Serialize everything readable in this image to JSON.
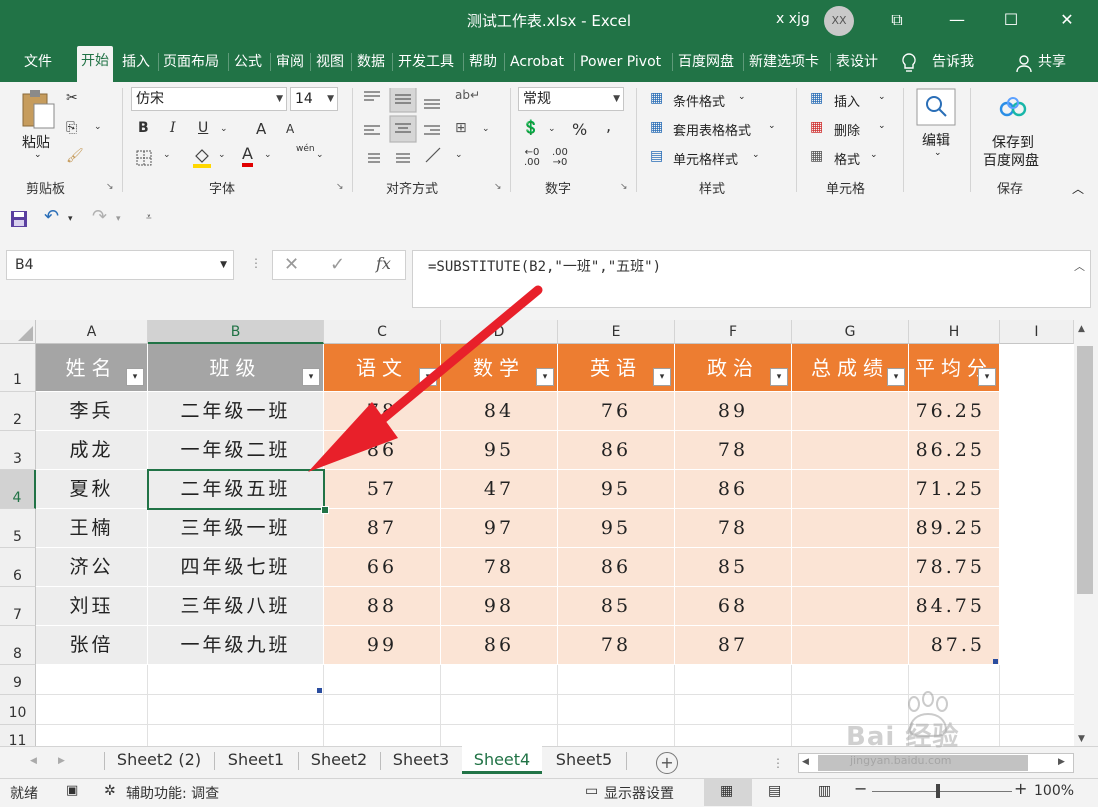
{
  "window": {
    "title": "测试工作表.xlsx  -  Excel",
    "user": "x xjg",
    "avatar": "XX",
    "minimize": "—",
    "maximize": "☐",
    "close": "✕",
    "restore": "⧉"
  },
  "menu": {
    "items": [
      "文件",
      "开始",
      "插入",
      "页面布局",
      "公式",
      "审阅",
      "视图",
      "数据",
      "开发工具",
      "帮助",
      "Acrobat",
      "Power Pivot",
      "百度网盘",
      "新建选项卡",
      "表设计"
    ],
    "tellme": "告诉我",
    "share": "共享"
  },
  "ribbon": {
    "clipboard": {
      "paste": "粘贴",
      "label": "剪贴板"
    },
    "font": {
      "name": "仿宋",
      "size": "14",
      "label": "字体",
      "bold": "B",
      "italic": "I",
      "underline": "U",
      "grow": "A",
      "shrink": "A",
      "color": "A",
      "wen": "wén"
    },
    "alignment": {
      "label": "对齐方式"
    },
    "number": {
      "format": "常规",
      "label": "数字",
      "percent": "%",
      "comma": ","
    },
    "styles": {
      "conditional": "条件格式",
      "table": "套用表格格式",
      "cell": "单元格样式",
      "label": "样式"
    },
    "cells": {
      "insert": "插入",
      "delete": "删除",
      "format": "格式",
      "label": "单元格"
    },
    "editing": {
      "label": "编辑"
    },
    "save": {
      "line1": "保存到",
      "line2": "百度网盘",
      "label": "保存"
    }
  },
  "formula_bar": {
    "name_box": "B4",
    "fx": "fx",
    "formula": "=SUBSTITUTE(B2,\"一班\",\"五班\")"
  },
  "grid": {
    "columns": [
      "A",
      "B",
      "C",
      "D",
      "E",
      "F",
      "G",
      "H",
      "I"
    ],
    "rows": [
      "1",
      "2",
      "3",
      "4",
      "5",
      "6",
      "7",
      "8",
      "9",
      "10",
      "11"
    ],
    "headers": [
      "姓名",
      "班级",
      "语文",
      "数学",
      "英语",
      "政治",
      "总成绩",
      "平均分"
    ],
    "data": [
      [
        "李兵",
        "二年级一班",
        "78",
        "84",
        "76",
        "89",
        "",
        "76.25"
      ],
      [
        "成龙",
        "一年级二班",
        "86",
        "95",
        "86",
        "78",
        "",
        "86.25"
      ],
      [
        "夏秋",
        "二年级五班",
        "57",
        "47",
        "95",
        "86",
        "",
        "71.25"
      ],
      [
        "王楠",
        "三年级一班",
        "87",
        "97",
        "95",
        "78",
        "",
        "89.25"
      ],
      [
        "济公",
        "四年级七班",
        "66",
        "78",
        "86",
        "85",
        "",
        "78.75"
      ],
      [
        "刘珏",
        "三年级八班",
        "88",
        "98",
        "85",
        "68",
        "",
        "84.75"
      ],
      [
        "张倍",
        "一年级九班",
        "99",
        "86",
        "78",
        "87",
        "",
        "87.5"
      ]
    ],
    "filter_glyph": "▾",
    "colors": {
      "header_gray": "#a5a5a5",
      "header_orange": "#ed7d31",
      "row_gray": "#ededed",
      "row_peach": "#fbe4d5",
      "annotation_red": "#e8202a"
    }
  },
  "sheets": {
    "tabs": [
      "Sheet2 (2)",
      "Sheet1",
      "Sheet2",
      "Sheet3",
      "Sheet4",
      "Sheet5"
    ],
    "active": "Sheet4",
    "add": "+"
  },
  "status": {
    "ready": "就绪",
    "accessibility": "辅助功能: 调查",
    "display": "显示器设置",
    "zoom": "100%"
  },
  "watermark": {
    "brand": "Bai 经验",
    "url": "jingyan.baidu.com"
  }
}
